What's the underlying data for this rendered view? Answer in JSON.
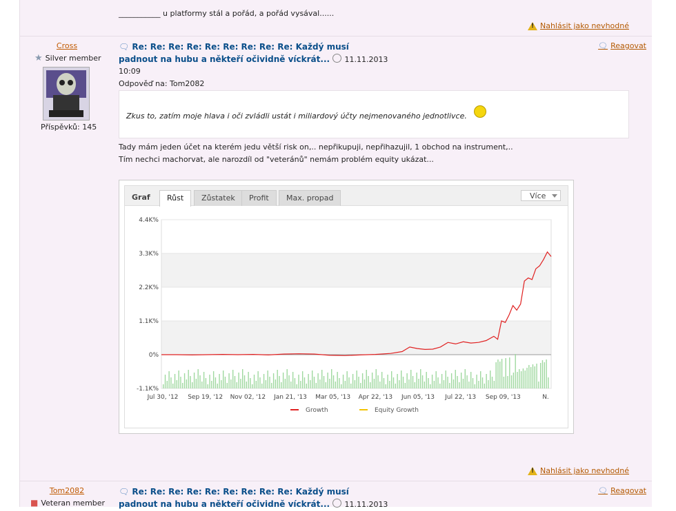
{
  "top_post": {
    "text": "___________ u platformy stál a pořád, a pořád vysával......",
    "report_label": "Nahlásit jako nevhodné"
  },
  "post1": {
    "author": "Cross",
    "rank": "Silver member",
    "posts_label": "Příspěvků: 145",
    "title_line1": "Re: Re: Re: Re: Re: Re: Re: Re: Re: Každý musí",
    "title_line2": "padnout na hubu a někteří očividně víckrát...",
    "date": "11.11.2013",
    "time": "10:09",
    "reply_to": "Odpověď na: Tom2082",
    "quote": "Zkus to, zatím moje hlava i oči zvládli ustát i miliardový účty nejmenovaného jednotlivce.",
    "body_line1": "Tady mám jeden účet na kterém jedu větší risk on,..  nepřikupuji, nepřihazujil, 1 obchod na instrument,..",
    "body_line2": "Tím nechci machorvat, ale narozdíl od \"veteránů\" nemám problém equity ukázat...",
    "reply_label": "Reagovat",
    "report_label": "Nahlásit jako nevhodné"
  },
  "post2": {
    "author": "Tom2082",
    "rank": "Veteran member",
    "title_line1": "Re: Re: Re: Re: Re: Re: Re: Re: Re: Každý musí",
    "title_line2": "padnout na hubu a někteří očividně víckrát...",
    "date": "11.11.2013",
    "reply_label": "Reagovat"
  },
  "chart_widget": {
    "graf_label": "Graf",
    "tabs": [
      "Růst",
      "Zůstatek",
      "Profit",
      "Max. propad"
    ],
    "active_tab": "Růst",
    "more_label": "Více"
  },
  "chart_data": {
    "type": "line",
    "y_ticks": [
      "4.4K%",
      "3.3K%",
      "2.2K%",
      "1.1K%",
      "0%",
      "-1.1K%"
    ],
    "ylim": [
      -1100,
      4400
    ],
    "x_ticks": [
      "Jul 30, '12",
      "Sep 19, '12",
      "Nov 02, '12",
      "Jan 21, '13",
      "Mar 05, '13",
      "Apr 22, '13",
      "Jun 05, '13",
      "Jul 22, '13",
      "Sep 09, '13",
      "N."
    ],
    "grid": true,
    "legend_position": "bottom",
    "series": [
      {
        "name": "Growth",
        "color": "#e02020",
        "points": [
          [
            0,
            0
          ],
          [
            4,
            0
          ],
          [
            8,
            -10
          ],
          [
            12,
            0
          ],
          [
            16,
            10
          ],
          [
            20,
            0
          ],
          [
            24,
            10
          ],
          [
            28,
            -10
          ],
          [
            32,
            20
          ],
          [
            36,
            30
          ],
          [
            40,
            20
          ],
          [
            44,
            -20
          ],
          [
            48,
            -30
          ],
          [
            52,
            -10
          ],
          [
            56,
            10
          ],
          [
            60,
            40
          ],
          [
            63,
            100
          ],
          [
            65,
            250
          ],
          [
            67,
            200
          ],
          [
            69,
            170
          ],
          [
            71,
            180
          ],
          [
            73,
            250
          ],
          [
            75,
            400
          ],
          [
            77,
            350
          ],
          [
            79,
            420
          ],
          [
            81,
            380
          ],
          [
            83,
            400
          ],
          [
            85,
            460
          ],
          [
            87,
            600
          ],
          [
            88,
            500
          ],
          [
            89,
            1100
          ],
          [
            90,
            1050
          ],
          [
            91,
            1300
          ],
          [
            92,
            1600
          ],
          [
            93,
            1450
          ],
          [
            94,
            1650
          ],
          [
            95,
            2400
          ],
          [
            96,
            2500
          ],
          [
            97,
            2450
          ],
          [
            98,
            2800
          ],
          [
            99,
            2900
          ],
          [
            100,
            3100
          ],
          [
            101,
            3350
          ],
          [
            102,
            3200
          ]
        ]
      },
      {
        "name": "Equity Growth",
        "color": "#f2c200",
        "points": []
      }
    ],
    "volume_color": "#9fd89f"
  }
}
